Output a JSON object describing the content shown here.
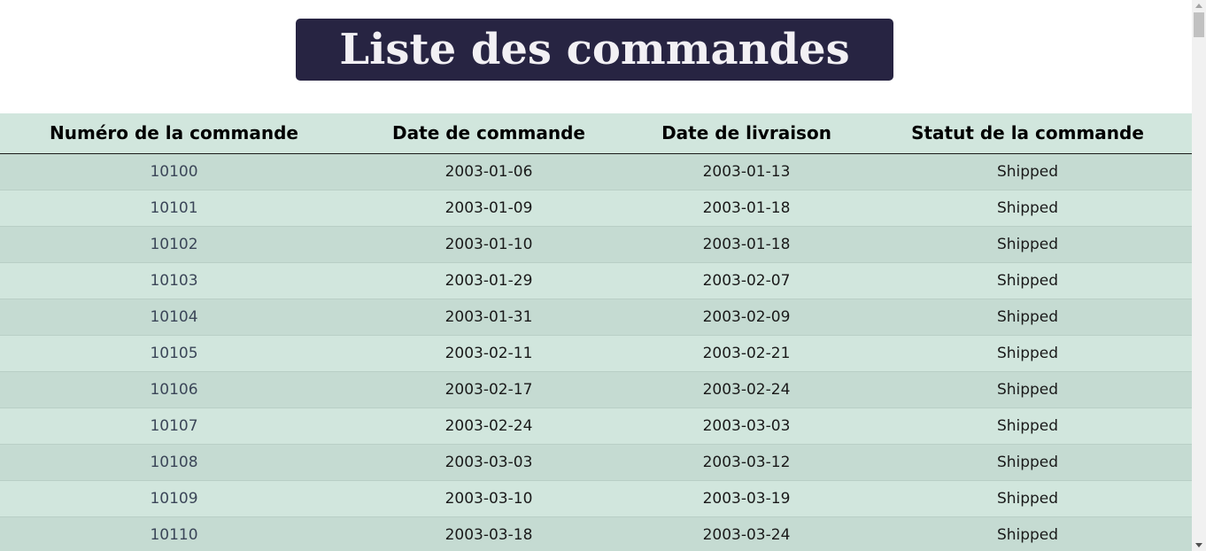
{
  "page": {
    "title": "Liste des commandes"
  },
  "table": {
    "headers": [
      "Numéro de la commande",
      "Date de commande",
      "Date de livraison",
      "Statut de la commande"
    ],
    "rows": [
      [
        "10100",
        "2003-01-06",
        "2003-01-13",
        "Shipped"
      ],
      [
        "10101",
        "2003-01-09",
        "2003-01-18",
        "Shipped"
      ],
      [
        "10102",
        "2003-01-10",
        "2003-01-18",
        "Shipped"
      ],
      [
        "10103",
        "2003-01-29",
        "2003-02-07",
        "Shipped"
      ],
      [
        "10104",
        "2003-01-31",
        "2003-02-09",
        "Shipped"
      ],
      [
        "10105",
        "2003-02-11",
        "2003-02-21",
        "Shipped"
      ],
      [
        "10106",
        "2003-02-17",
        "2003-02-24",
        "Shipped"
      ],
      [
        "10107",
        "2003-02-24",
        "2003-03-03",
        "Shipped"
      ],
      [
        "10108",
        "2003-03-03",
        "2003-03-12",
        "Shipped"
      ],
      [
        "10109",
        "2003-03-10",
        "2003-03-19",
        "Shipped"
      ],
      [
        "10110",
        "2003-03-18",
        "2003-03-24",
        "Shipped"
      ]
    ]
  },
  "colors": {
    "title_background": "#272442",
    "title_text": "#f2f0f4",
    "row_odd": "#c5dbd2",
    "row_even": "#d1e6dd",
    "header_background": "#d1e6dd"
  },
  "scrollbar": {
    "icon_up": "scroll-up-arrow-icon",
    "icon_down": "scroll-down-arrow-icon"
  }
}
